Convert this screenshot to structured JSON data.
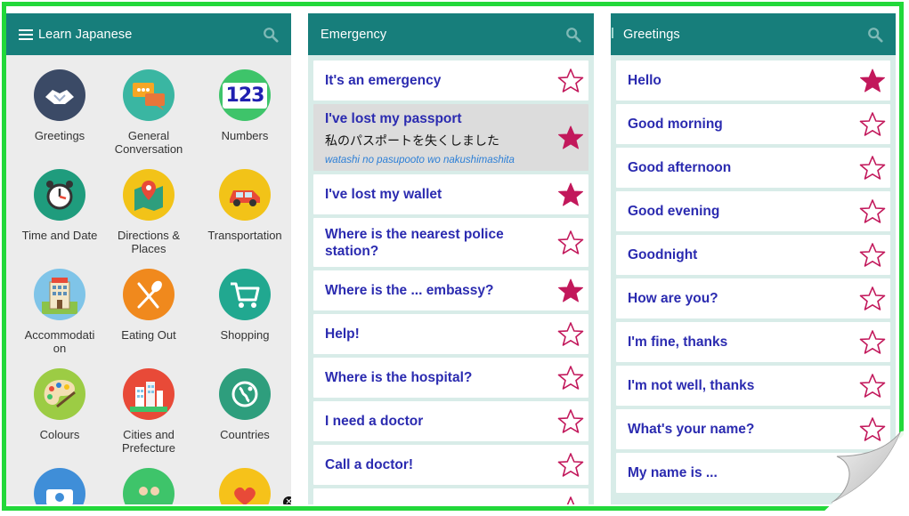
{
  "panels": [
    {
      "title": "Learn Japanese",
      "categories": [
        {
          "label": "Greetings",
          "icon": "handshake-icon",
          "color": "#3b4a66"
        },
        {
          "label": "General\nConversation",
          "icon": "chat-bubbles-icon",
          "color": "#3ab6a2"
        },
        {
          "label": "Numbers",
          "icon": "numbers-icon",
          "color": "#3ec46a",
          "glyph": "123"
        },
        {
          "label": "Time and Date",
          "icon": "alarm-clock-icon",
          "color": "#1f9c7d"
        },
        {
          "label": "Directions &\nPlaces",
          "icon": "map-pin-icon",
          "color": "#f2c318"
        },
        {
          "label": "Transportation",
          "icon": "car-icon",
          "color": "#f2c318"
        },
        {
          "label": "Accommodati\non",
          "icon": "hotel-icon",
          "color": "#7fc4e8"
        },
        {
          "label": "Eating Out",
          "icon": "fork-spoon-icon",
          "color": "#f0891d"
        },
        {
          "label": "Shopping",
          "icon": "shopping-cart-icon",
          "color": "#21a890"
        },
        {
          "label": "Colours",
          "icon": "palette-icon",
          "color": "#9ccc44"
        },
        {
          "label": "Cities and\nPrefecture",
          "icon": "city-icon",
          "color": "#e84a38"
        },
        {
          "label": "Countries",
          "icon": "globe-icon",
          "color": "#2e9e7d"
        },
        {
          "label": "",
          "icon": "camera-icon",
          "color": "#3f8ed8"
        },
        {
          "label": "",
          "icon": "people-icon",
          "color": "#3ec46a"
        },
        {
          "label": "",
          "icon": "heart-icon",
          "color": "#f6c21a"
        }
      ]
    },
    {
      "title": "Emergency",
      "items": [
        {
          "phrase": "It's an emergency",
          "starred": false
        },
        {
          "phrase": "I've lost my passport",
          "native": "私のパスポートを失くしました",
          "romaji": "watashi no pasupooto wo nakushimashita",
          "starred": true,
          "selected": true
        },
        {
          "phrase": "I've lost my wallet",
          "starred": true
        },
        {
          "phrase": "Where is the nearest police station?",
          "starred": false
        },
        {
          "phrase": "Where is the ... embassy?",
          "starred": true
        },
        {
          "phrase": "Help!",
          "starred": false
        },
        {
          "phrase": "Where is the hospital?",
          "starred": false
        },
        {
          "phrase": "I need a doctor",
          "starred": false
        },
        {
          "phrase": "Call a doctor!",
          "starred": false
        },
        {
          "phrase": "",
          "starred": false
        }
      ]
    },
    {
      "title": "Greetings",
      "items": [
        {
          "phrase": "Hello",
          "starred": true
        },
        {
          "phrase": "Good morning",
          "starred": false
        },
        {
          "phrase": "Good afternoon",
          "starred": false
        },
        {
          "phrase": "Good evening",
          "starred": false
        },
        {
          "phrase": "Goodnight",
          "starred": false
        },
        {
          "phrase": "How are you?",
          "starred": false
        },
        {
          "phrase": "I'm fine, thanks",
          "starred": false
        },
        {
          "phrase": "I'm not well, thanks",
          "starred": false
        },
        {
          "phrase": "What's your name?",
          "starred": false
        },
        {
          "phrase": "My name is ...",
          "starred": false
        }
      ]
    }
  ],
  "colors": {
    "appbar": "#177e7b",
    "phrase": "#2b2bb0",
    "romaji": "#2c7fd6",
    "star": "#c2185b",
    "frame": "#22d83a"
  },
  "close_badge": "✕"
}
